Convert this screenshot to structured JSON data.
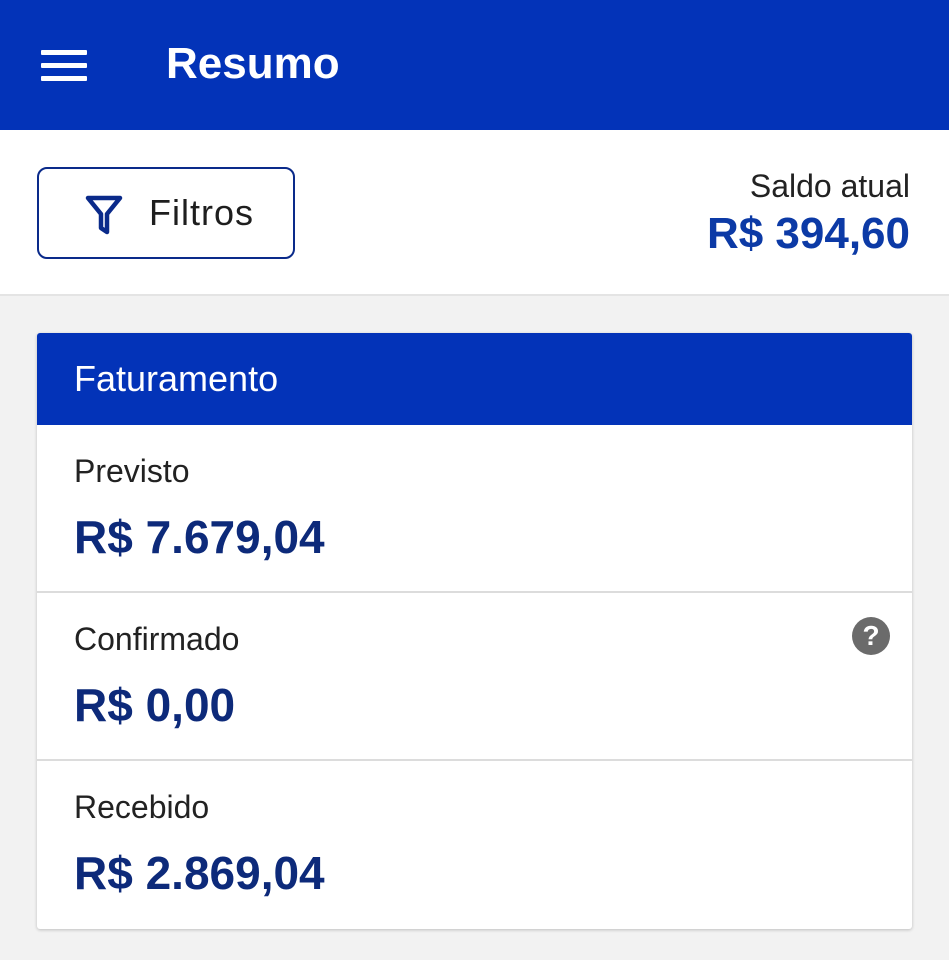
{
  "header": {
    "title": "Resumo",
    "menu_icon": "menu-icon",
    "background": "#0333b8"
  },
  "toolbar": {
    "filter_label": "Filtros",
    "filter_icon": "filter-icon",
    "balance_label": "Saldo atual",
    "balance_value": "R$ 394,60",
    "balance_color": "#0c3aa6"
  },
  "card": {
    "title": "Faturamento",
    "rows": [
      {
        "label": "Previsto",
        "value": "R$ 7.679,04"
      },
      {
        "label": "Confirmado",
        "value": "R$ 0,00",
        "help_icon": "help-icon",
        "help_glyph": "?"
      },
      {
        "label": "Recebido",
        "value": "R$ 2.869,04"
      }
    ]
  }
}
